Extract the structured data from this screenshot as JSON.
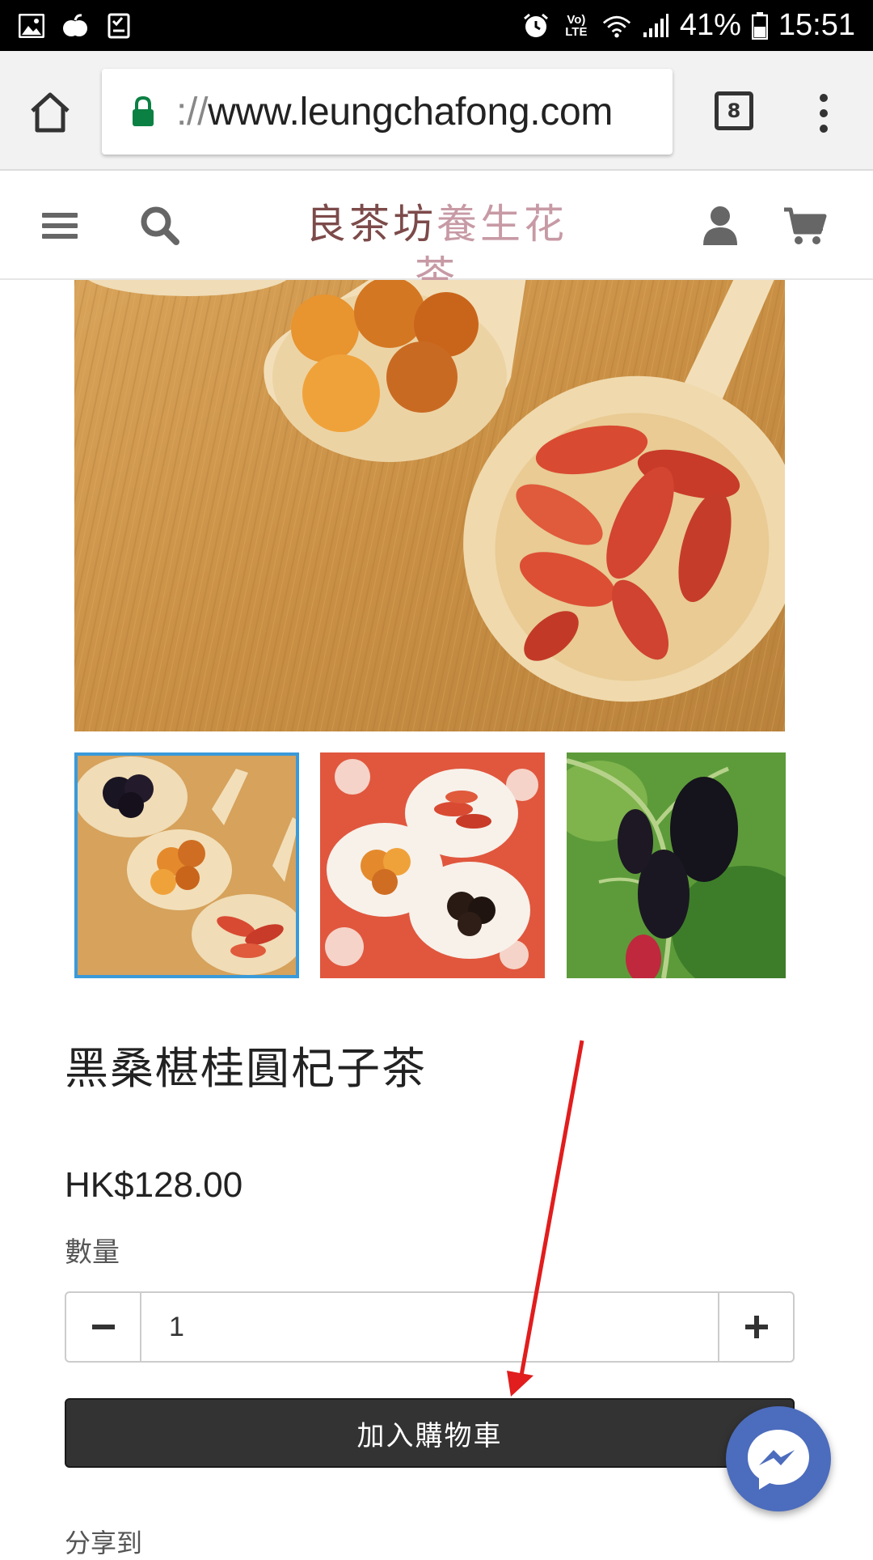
{
  "status_bar": {
    "network_label": "Vo) LTE",
    "battery": "41%",
    "time": "15:51",
    "left_icons": [
      "gallery-icon",
      "fruit-icon",
      "checklist-icon"
    ],
    "right_icons": [
      "alarm-icon",
      "wifi-icon",
      "signal-icon",
      "battery-icon"
    ]
  },
  "browser": {
    "url_scheme": "://",
    "url_host": "www.leungchafong.com",
    "tab_count": "8"
  },
  "site": {
    "logo_part1": "良茶坊",
    "logo_part2": "養生花茶"
  },
  "product": {
    "title": "黑桑椹桂圓杞子茶",
    "price": "HK$128.00",
    "quantity_label": "數量",
    "quantity_value": "1",
    "add_to_cart": "加入購物車",
    "share_label": "分享到"
  },
  "gallery": {
    "main_image": "dried-fruit-spoons-photo",
    "thumbnails": [
      "mulberry-longan-goji-spoons-photo",
      "three-spoons-on-red-cloth-photo",
      "mulberries-on-branch-photo"
    ],
    "active_thumbnail": 0
  },
  "colors": {
    "accent_thumb_border": "#3a9ad9",
    "cart_button": "#333333",
    "messenger": "#4c6cbd",
    "annotation_arrow": "#e11d1d",
    "secure_lock": "#0b8043"
  }
}
